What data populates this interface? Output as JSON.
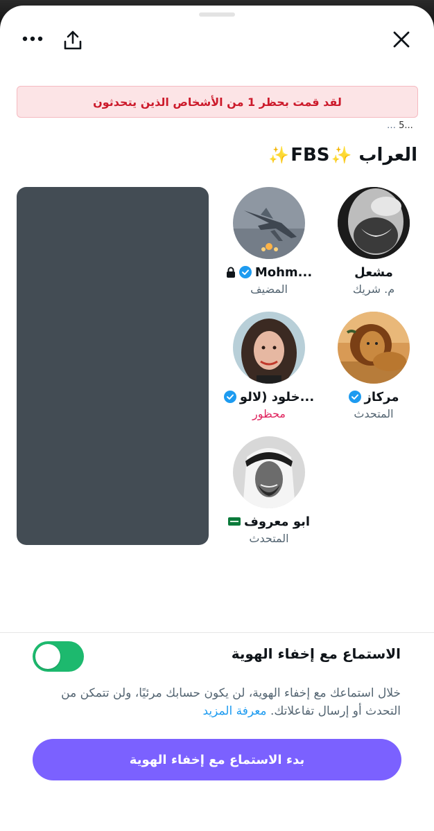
{
  "header": {
    "close_icon": "close-icon",
    "share_icon": "share-icon",
    "more_icon": "more-icon"
  },
  "banner": {
    "prefix": "لقد قمت بحظر",
    "count": "1",
    "suffix": "من الأشخاص الذين يتحدثون"
  },
  "listener_count": {
    "value": "5",
    "ellipsis_before": "…",
    "ellipsis_after": "..."
  },
  "space": {
    "title_word": "العراب",
    "title_tag": "FBS",
    "sparkle": "✨"
  },
  "speakers": [
    {
      "name": "مشعل",
      "role": "م. شريك",
      "verified": false
    },
    {
      "name": "Mohm...",
      "role": "المضيف",
      "verified": true,
      "locked": true
    },
    {
      "name": "مركاز",
      "role": "المتحدث",
      "verified": true
    },
    {
      "name": "خلود (لالو...",
      "role": "محظور",
      "verified": true,
      "banned": true
    },
    {
      "name": "ابو معروف",
      "role": "المتحدث",
      "verified": false,
      "flag": "saudi-flag"
    }
  ],
  "anonymous": {
    "label": "الاستماع مع إخفاء الهوية",
    "toggle_on": true,
    "description": "خلال استماعك مع إخفاء الهوية، لن يكون حسابك مرئيًا، ولن تتمكن من التحدث أو إرسال تفاعلاتك.",
    "learn_more": "معرفة المزيد",
    "start_button": "بدء الاستماع مع إخفاء الهوية"
  },
  "colors": {
    "accent": "#7b61ff",
    "toggle": "#1db96e",
    "banned": "#e0245e",
    "verified": "#1d9bf0",
    "banner_bg": "#fce4e6",
    "banner_text": "#cc1a2b"
  }
}
